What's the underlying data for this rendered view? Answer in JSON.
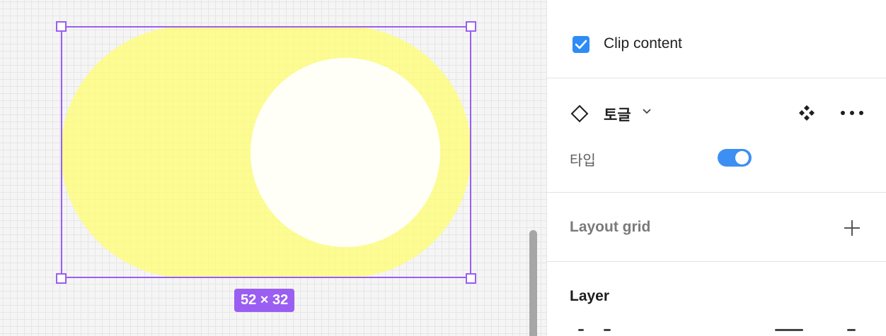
{
  "canvas": {
    "selection_size_label": "52 × 32",
    "colors": {
      "selection": "#9a5ef2",
      "toggle_track": "#ffff6e",
      "toggle_knob": "#ffffff"
    }
  },
  "panel": {
    "clip_content": {
      "label": "Clip content",
      "checked": true
    },
    "component": {
      "icon": "component-diamond-icon",
      "name": "토글",
      "properties": [
        {
          "label": "타입",
          "type": "boolean",
          "value": true
        }
      ]
    },
    "layout_grid": {
      "title": "Layout grid"
    },
    "layer": {
      "title": "Layer"
    },
    "colors": {
      "accent": "#2f8cf6"
    }
  }
}
